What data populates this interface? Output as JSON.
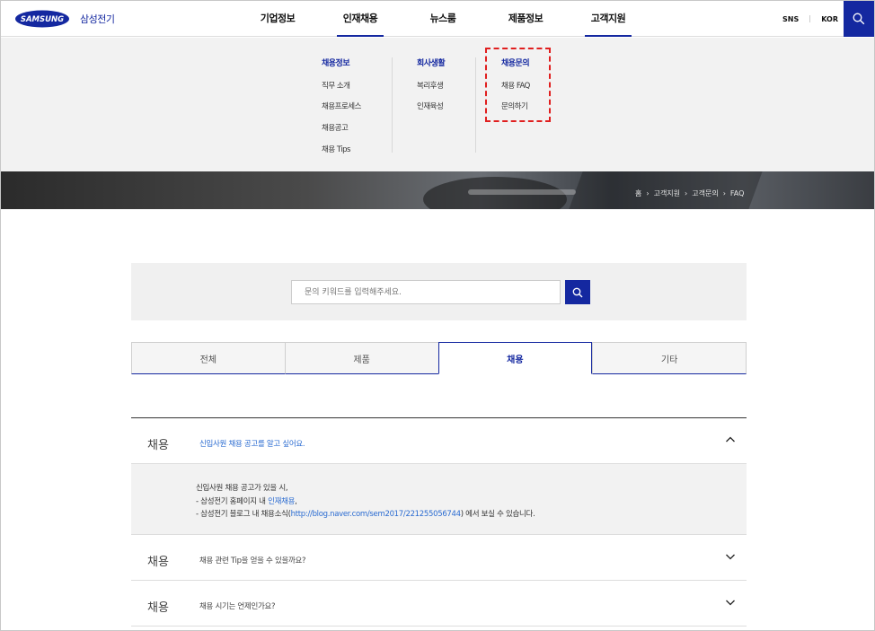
{
  "header": {
    "logo_text": "SAMSUNG",
    "logo_sub": "삼성전기",
    "nav": [
      "기업정보",
      "인재채용",
      "뉴스룸",
      "제품정보",
      "고객지원"
    ],
    "active_nav_index": 4,
    "util": {
      "sns": "SNS",
      "lang": "KOR"
    },
    "icons": {
      "search": "search-icon"
    },
    "brand_color": "#1428a0"
  },
  "mega_menu": {
    "columns": [
      {
        "title": "채용정보",
        "items": [
          "직무 소개",
          "채용프로세스",
          "채용공고",
          "채용 Tips"
        ]
      },
      {
        "title": "회사생활",
        "items": [
          "복리후생",
          "인재육성"
        ]
      },
      {
        "title": "채용문의",
        "items": [
          "채용 FAQ",
          "문의하기"
        ]
      }
    ],
    "highlight_color": "#e01f1f"
  },
  "breadcrumb": [
    "홈",
    "고객지원",
    "고객문의",
    "FAQ"
  ],
  "search": {
    "placeholder": "문의 키워드를 입력해주세요."
  },
  "tabs": [
    "전체",
    "제품",
    "채용",
    "기타"
  ],
  "active_tab_index": 2,
  "faq": [
    {
      "category": "채용",
      "question": "신입사원 채용 공고를 알고 싶어요.",
      "open": true,
      "answer": {
        "line1": "신입사원 채용 공고가 있을 시,",
        "line2_pre": "- 삼성전기 홈페이지 내 ",
        "line2_link": "인재채용",
        "line2_post": ",",
        "line3_pre": "- 삼성전기 블로그 내 채용소식(",
        "line3_link": "http://blog.naver.com/sem2017/221255056744",
        "line3_post": ") 에서 보실 수 있습니다."
      }
    },
    {
      "category": "채용",
      "question": "채용 관련 Tip을 얻을 수 있을까요?",
      "open": false
    },
    {
      "category": "채용",
      "question": "채용 시기는 언제인가요?",
      "open": false
    }
  ]
}
